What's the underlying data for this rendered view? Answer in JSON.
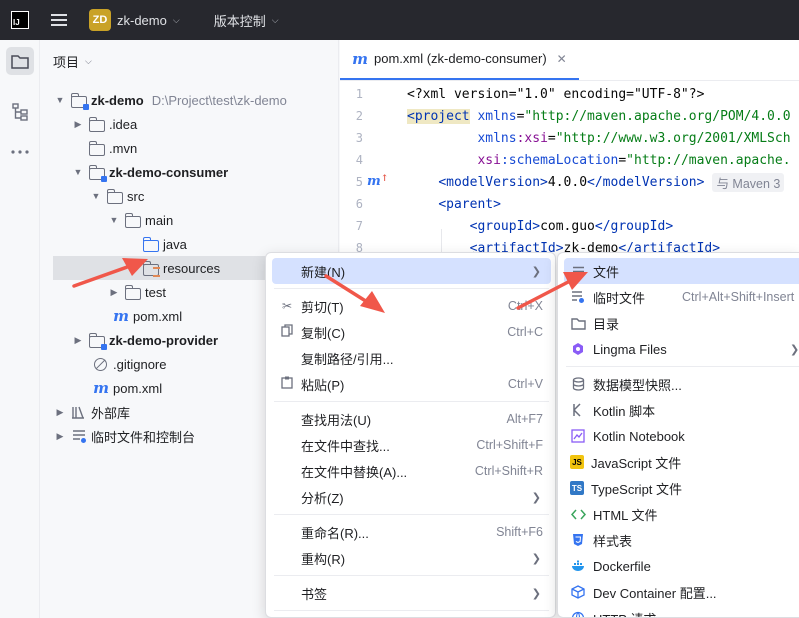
{
  "titlebar": {
    "logo_text": "IJ",
    "project_badge": "ZD",
    "project_name": "zk-demo",
    "vcs_label": "版本控制"
  },
  "project_panel": {
    "title": "项目",
    "tree": [
      {
        "label": "zk-demo",
        "path": "D:\\Project\\test\\zk-demo"
      },
      {
        "label": ".idea"
      },
      {
        "label": ".mvn"
      },
      {
        "label": "zk-demo-consumer"
      },
      {
        "label": "src"
      },
      {
        "label": "main"
      },
      {
        "label": "java"
      },
      {
        "label": "resources"
      },
      {
        "label": "test"
      },
      {
        "label": "pom.xml"
      },
      {
        "label": "zk-demo-provider"
      },
      {
        "label": ".gitignore"
      },
      {
        "label": "pom.xml"
      },
      {
        "label": "外部库"
      },
      {
        "label": "临时文件和控制台"
      }
    ]
  },
  "editor": {
    "tab_label": "pom.xml (zk-demo-consumer)",
    "tab_close": "✕",
    "line_numbers": [
      "1",
      "2",
      "3",
      "4",
      "5",
      "6",
      "7",
      "8"
    ],
    "lines": {
      "l1": "<?xml version=\"1.0\" encoding=\"UTF-8\"?>",
      "l2_tag": "<project",
      "l2_attr": " xmlns",
      "l2_eq": "=",
      "l2_val": "\"http://maven.apache.org/POM/4.0.0",
      "l3_ns": "xmlns",
      "l3_attr": ":xsi",
      "l3_eq": "=",
      "l3_val": "\"http://www.w3.org/2001/XMLSch",
      "l4_ns": "xsi",
      "l4_attr": ":schemaLocation",
      "l4_eq": "=",
      "l4_val": "\"http://maven.apache.",
      "l5_open": "<modelVersion>",
      "l5_text": "4.0.0",
      "l5_close": "</modelVersion>",
      "l5_hint": "与 Maven 3",
      "l6": "<parent>",
      "l7_open": "<groupId>",
      "l7_text": "com.guo",
      "l7_close": "</groupId>",
      "l8_open": "<artifactId>",
      "l8_text": "zk-demo",
      "l8_close": "</artifactId>"
    }
  },
  "context_menu": {
    "items": [
      {
        "label": "新建(N)",
        "shortcut": "",
        "icon": "",
        "submenu": true
      },
      {
        "label": "剪切(T)",
        "shortcut": "Ctrl+X",
        "icon": "scissors-icon"
      },
      {
        "label": "复制(C)",
        "shortcut": "Ctrl+C",
        "icon": "copy-icon"
      },
      {
        "label": "复制路径/引用...",
        "shortcut": "",
        "icon": ""
      },
      {
        "label": "粘贴(P)",
        "shortcut": "Ctrl+V",
        "icon": "paste-icon"
      },
      {
        "label": "查找用法(U)",
        "shortcut": "Alt+F7",
        "icon": ""
      },
      {
        "label": "在文件中查找...",
        "shortcut": "Ctrl+Shift+F",
        "icon": ""
      },
      {
        "label": "在文件中替换(A)...",
        "shortcut": "Ctrl+Shift+R",
        "icon": ""
      },
      {
        "label": "分析(Z)",
        "shortcut": "",
        "icon": "",
        "submenu": true
      },
      {
        "label": "重命名(R)...",
        "shortcut": "Shift+F6",
        "icon": ""
      },
      {
        "label": "重构(R)",
        "shortcut": "",
        "icon": "",
        "submenu": true
      },
      {
        "label": "书签",
        "shortcut": "",
        "icon": "",
        "submenu": true
      }
    ]
  },
  "new_submenu": {
    "items": [
      {
        "label": "文件",
        "shortcut": ""
      },
      {
        "label": "临时文件",
        "shortcut": "Ctrl+Alt+Shift+Insert"
      },
      {
        "label": "目录",
        "shortcut": ""
      },
      {
        "label": "Lingma Files",
        "shortcut": ""
      },
      {
        "label": "数据模型快照...",
        "shortcut": ""
      },
      {
        "label": "Kotlin 脚本",
        "shortcut": ""
      },
      {
        "label": "Kotlin Notebook",
        "shortcut": ""
      },
      {
        "label": "JavaScript 文件",
        "shortcut": "",
        "badge": "JS"
      },
      {
        "label": "TypeScript 文件",
        "shortcut": "",
        "badge": "TS"
      },
      {
        "label": "HTML 文件",
        "shortcut": ""
      },
      {
        "label": "样式表",
        "shortcut": ""
      },
      {
        "label": "Dockerfile",
        "shortcut": ""
      },
      {
        "label": "Dev Container 配置...",
        "shortcut": ""
      },
      {
        "label": "HTTP 请求",
        "shortcut": ""
      }
    ]
  },
  "colors": {
    "accent": "#3574f0",
    "selection": "#d5e1ff",
    "annotation_arrow": "#f0574a"
  }
}
